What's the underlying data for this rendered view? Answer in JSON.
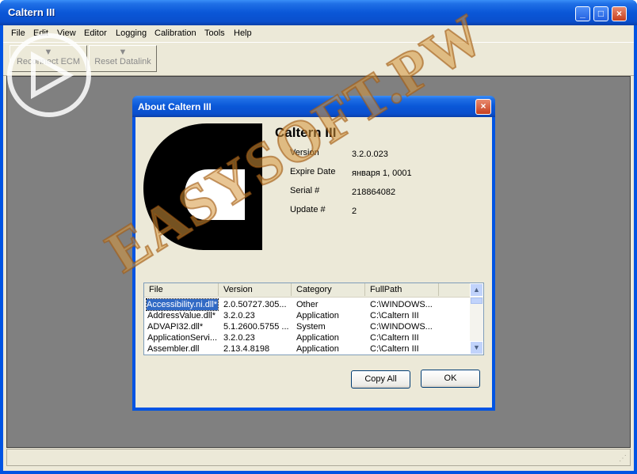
{
  "window": {
    "title": "Caltern III",
    "controls": {
      "minimize": "_",
      "maximize": "□",
      "close": "×"
    }
  },
  "menu": [
    "File",
    "Edit",
    "View",
    "Editor",
    "Logging",
    "Calibration",
    "Tools",
    "Help"
  ],
  "toolbar": {
    "reconnect_label": "Reconnect ECM",
    "reset_label": "Reset Datalink"
  },
  "dialog": {
    "title": "About Caltern III",
    "close": "×",
    "app_name": "Caltern III",
    "fields": [
      {
        "label": "Version",
        "value": "3.2.0.023"
      },
      {
        "label": "Expire Date",
        "value": "января 1, 0001"
      },
      {
        "label": "Serial #",
        "value": "218864082"
      },
      {
        "label": "Update #",
        "value": "2"
      }
    ],
    "list": {
      "columns": [
        "File",
        "Version",
        "Category",
        "FullPath"
      ],
      "rows": [
        [
          "Accessibility.ni.dll*",
          "2.0.50727.305...",
          "Other",
          "C:\\WINDOWS..."
        ],
        [
          "AddressValue.dll*",
          "3.2.0.23",
          "Application",
          "C:\\Caltern III"
        ],
        [
          "ADVAPI32.dll*",
          "5.1.2600.5755 ...",
          "System",
          "C:\\WINDOWS..."
        ],
        [
          "ApplicationServi...",
          "3.2.0.23",
          "Application",
          "C:\\Caltern III"
        ],
        [
          "Assembler.dll",
          "2.13.4.8198",
          "Application",
          "C:\\Caltern III"
        ]
      ],
      "scroll_up": "▲",
      "scroll_down": "▼"
    },
    "copy_all_label": "Copy All",
    "ok_label": "OK"
  },
  "watermark": "EASYSOFT.PW",
  "colors": {
    "titlebar": "#0a57d7",
    "face": "#ece9d8",
    "mdi": "#808080",
    "selection": "#316ac5"
  }
}
